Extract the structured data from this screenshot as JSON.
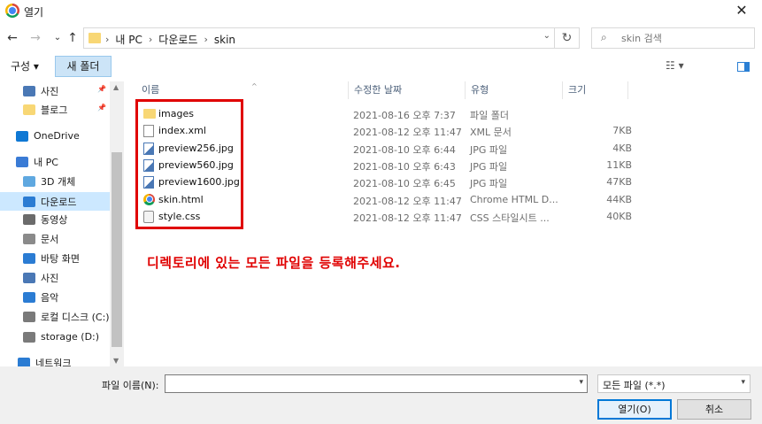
{
  "window": {
    "title": "열기",
    "close_glyph": "✕"
  },
  "nav_buttons": {
    "back": "←",
    "forward": "→",
    "recent": "⌄",
    "up": "↑"
  },
  "breadcrumbs": [
    "내 PC",
    "다운로드",
    "skin"
  ],
  "breadcrumb_separator": "›",
  "address_dropdown": "⌄",
  "refresh_glyph": "↻",
  "search": {
    "placeholder": "skin 검색",
    "icon": "search-icon"
  },
  "toolbar": {
    "organize_label": "구성 ▾",
    "new_folder_label": "새 폴더",
    "view_label": "☷ ▾"
  },
  "sidebar": {
    "items": [
      {
        "label": "사진",
        "icon": "pictures-icon",
        "color": "#4a78b5",
        "pinned": true
      },
      {
        "label": "블로그",
        "icon": "folder-icon",
        "color": "#f8d775",
        "pinned": true
      },
      {
        "label": "OneDrive",
        "icon": "onedrive-icon",
        "color": "#0f78d4"
      },
      {
        "label": "내 PC",
        "icon": "pc-icon",
        "color": "#3a7bd5"
      },
      {
        "label": "3D 개체",
        "icon": "3d-objects-icon",
        "color": "#5fa8e0"
      },
      {
        "label": "다운로드",
        "icon": "download-icon",
        "color": "#2b7cd3",
        "selected": true
      },
      {
        "label": "동영상",
        "icon": "videos-icon",
        "color": "#6b6b6b"
      },
      {
        "label": "문서",
        "icon": "documents-icon",
        "color": "#8a8a8a"
      },
      {
        "label": "바탕 화면",
        "icon": "desktop-icon",
        "color": "#2b7cd3"
      },
      {
        "label": "사진",
        "icon": "pictures-icon",
        "color": "#4a78b5"
      },
      {
        "label": "음악",
        "icon": "music-icon",
        "color": "#2b7cd3"
      },
      {
        "label": "로컬 디스크 (C:)",
        "icon": "drive-icon",
        "color": "#7a7a7a"
      },
      {
        "label": "storage (D:)",
        "icon": "drive-icon",
        "color": "#7a7a7a"
      },
      {
        "label": "네트워크",
        "icon": "network-icon",
        "color": "#2b7cd3"
      }
    ]
  },
  "columns": {
    "name": "이름",
    "date": "수정한 날짜",
    "type": "유형",
    "size": "크기"
  },
  "files": [
    {
      "name": "images",
      "date": "2021-08-16 오후 7:37",
      "type": "파일 폴더",
      "size": "",
      "icon": "folder"
    },
    {
      "name": "index.xml",
      "date": "2021-08-12 오후 11:47",
      "type": "XML 문서",
      "size": "7KB",
      "icon": "doc"
    },
    {
      "name": "preview256.jpg",
      "date": "2021-08-10 오후 6:44",
      "type": "JPG 파일",
      "size": "4KB",
      "icon": "img"
    },
    {
      "name": "preview560.jpg",
      "date": "2021-08-10 오후 6:43",
      "type": "JPG 파일",
      "size": "11KB",
      "icon": "img"
    },
    {
      "name": "preview1600.jpg",
      "date": "2021-08-10 오후 6:45",
      "type": "JPG 파일",
      "size": "47KB",
      "icon": "img"
    },
    {
      "name": "skin.html",
      "date": "2021-08-12 오후 11:47",
      "type": "Chrome HTML D...",
      "size": "44KB",
      "icon": "chrome"
    },
    {
      "name": "style.css",
      "date": "2021-08-12 오후 11:47",
      "type": "CSS 스타일시트 ...",
      "size": "40KB",
      "icon": "css"
    }
  ],
  "annotation": {
    "text": "디렉토리에 있는 모든 파일을 등록해주세요.",
    "color": "#e00000"
  },
  "bottom": {
    "filename_label": "파일 이름(N):",
    "filename_value": "",
    "filetype_value": "모든 파일 (*.*)",
    "open_label": "열기(O)",
    "cancel_label": "취소"
  }
}
